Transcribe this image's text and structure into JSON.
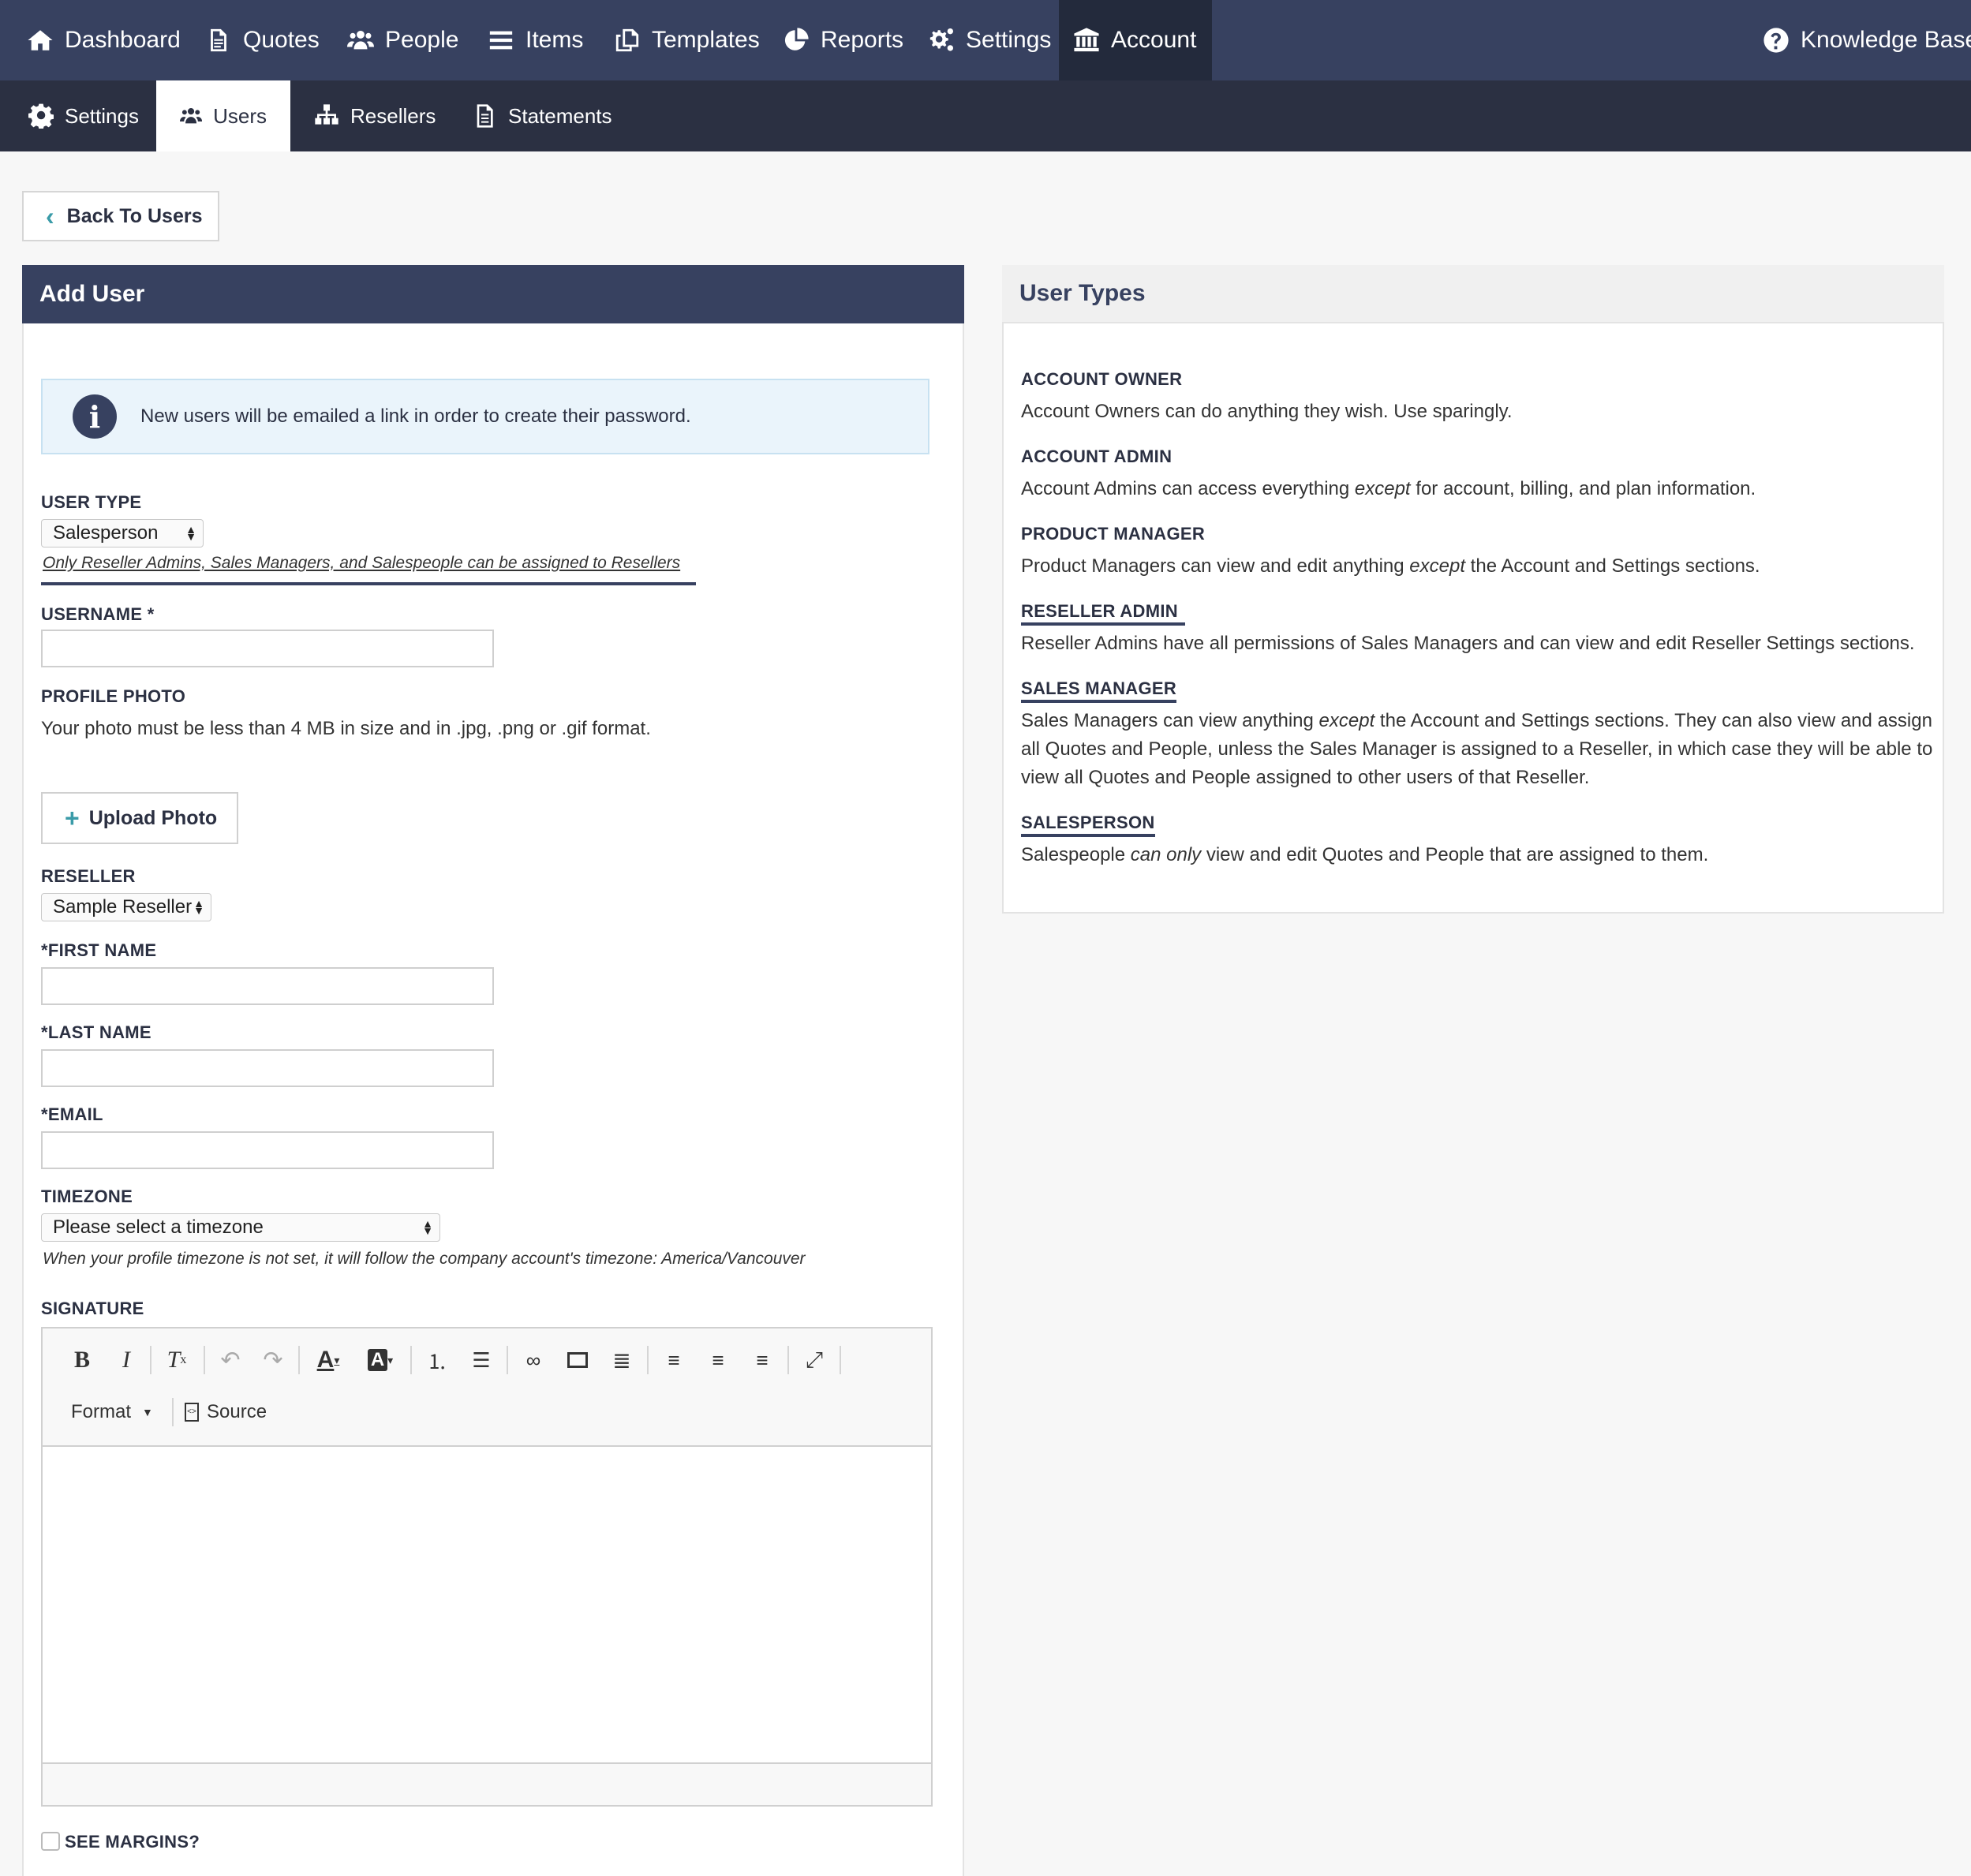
{
  "topnav": {
    "items": [
      {
        "label": "Dashboard",
        "icon": "home-icon"
      },
      {
        "label": "Quotes",
        "icon": "document-icon"
      },
      {
        "label": "People",
        "icon": "users-icon"
      },
      {
        "label": "Items",
        "icon": "list-icon"
      },
      {
        "label": "Templates",
        "icon": "copy-icon"
      },
      {
        "label": "Reports",
        "icon": "pie-chart-icon"
      },
      {
        "label": "Settings",
        "icon": "gears-icon"
      },
      {
        "label": "Account",
        "icon": "bank-icon"
      }
    ],
    "active": "Account",
    "knowledge_base": "Knowledge Base"
  },
  "subnav": {
    "items": [
      {
        "label": "Settings",
        "icon": "gear-icon"
      },
      {
        "label": "Users",
        "icon": "users-icon"
      },
      {
        "label": "Resellers",
        "icon": "sitemap-icon"
      },
      {
        "label": "Statements",
        "icon": "file-text-icon"
      }
    ],
    "active": "Users"
  },
  "back_button": "Back To Users",
  "form": {
    "title": "Add User",
    "info": "New users will be emailed a link in order to create their password.",
    "user_type": {
      "label": "USER TYPE",
      "value": "Salesperson",
      "hint": "Only Reseller Admins, Sales Managers, and Salespeople can be assigned to Resellers"
    },
    "username": {
      "label": "USERNAME *",
      "value": ""
    },
    "profile_photo": {
      "label": "PROFILE PHOTO",
      "hint": "Your photo must be less than 4 MB in size and in .jpg, .png or .gif format.",
      "upload_button": "Upload Photo"
    },
    "reseller": {
      "label": "RESELLER",
      "value": "Sample Reseller"
    },
    "first_name": {
      "label": "*FIRST NAME",
      "value": ""
    },
    "last_name": {
      "label": "*LAST NAME",
      "value": ""
    },
    "email": {
      "label": "*EMAIL",
      "value": ""
    },
    "timezone": {
      "label": "TIMEZONE",
      "value": "Please select a timezone",
      "hint": "When your profile timezone is not set, it will follow the company account's timezone: America/Vancouver"
    },
    "signature": {
      "label": "SIGNATURE",
      "format_label": "Format",
      "source_label": "Source"
    },
    "see_margins": {
      "label": "SEE MARGINS?",
      "checked": false
    }
  },
  "user_types": {
    "title": "User Types",
    "account_owner": {
      "title": "ACCOUNT OWNER",
      "text": "Account Owners can do anything they wish. Use sparingly."
    },
    "account_admin": {
      "title": "ACCOUNT ADMIN",
      "text_before": "Account Admins can access everything ",
      "emph": "except",
      "text_after": " for account, billing, and plan information."
    },
    "product_manager": {
      "title": "PRODUCT MANAGER",
      "text_before": "Product Managers can view and edit anything ",
      "emph": "except",
      "text_after": " the Account and Settings sections."
    },
    "reseller_admin": {
      "title": "RESELLER ADMIN",
      "text": "Reseller Admins have all permissions of Sales Managers and can view and edit Reseller Settings sections."
    },
    "sales_manager": {
      "title": "SALES MANAGER",
      "line1_before": "Sales Managers can view anything ",
      "emph": "except",
      "line1_after": " the Account and Settings sections. They can also view and assign",
      "line2": "all Quotes and People, unless the Sales Manager is assigned to a Reseller, in which case they will be able to",
      "line3": "view all Quotes and People assigned to other users of that Reseller."
    },
    "salesperson": {
      "title": "SALESPERSON",
      "text_before": "Salespeople ",
      "emph": "can only",
      "text_after": " view and edit Quotes and People that are assigned to them."
    }
  }
}
